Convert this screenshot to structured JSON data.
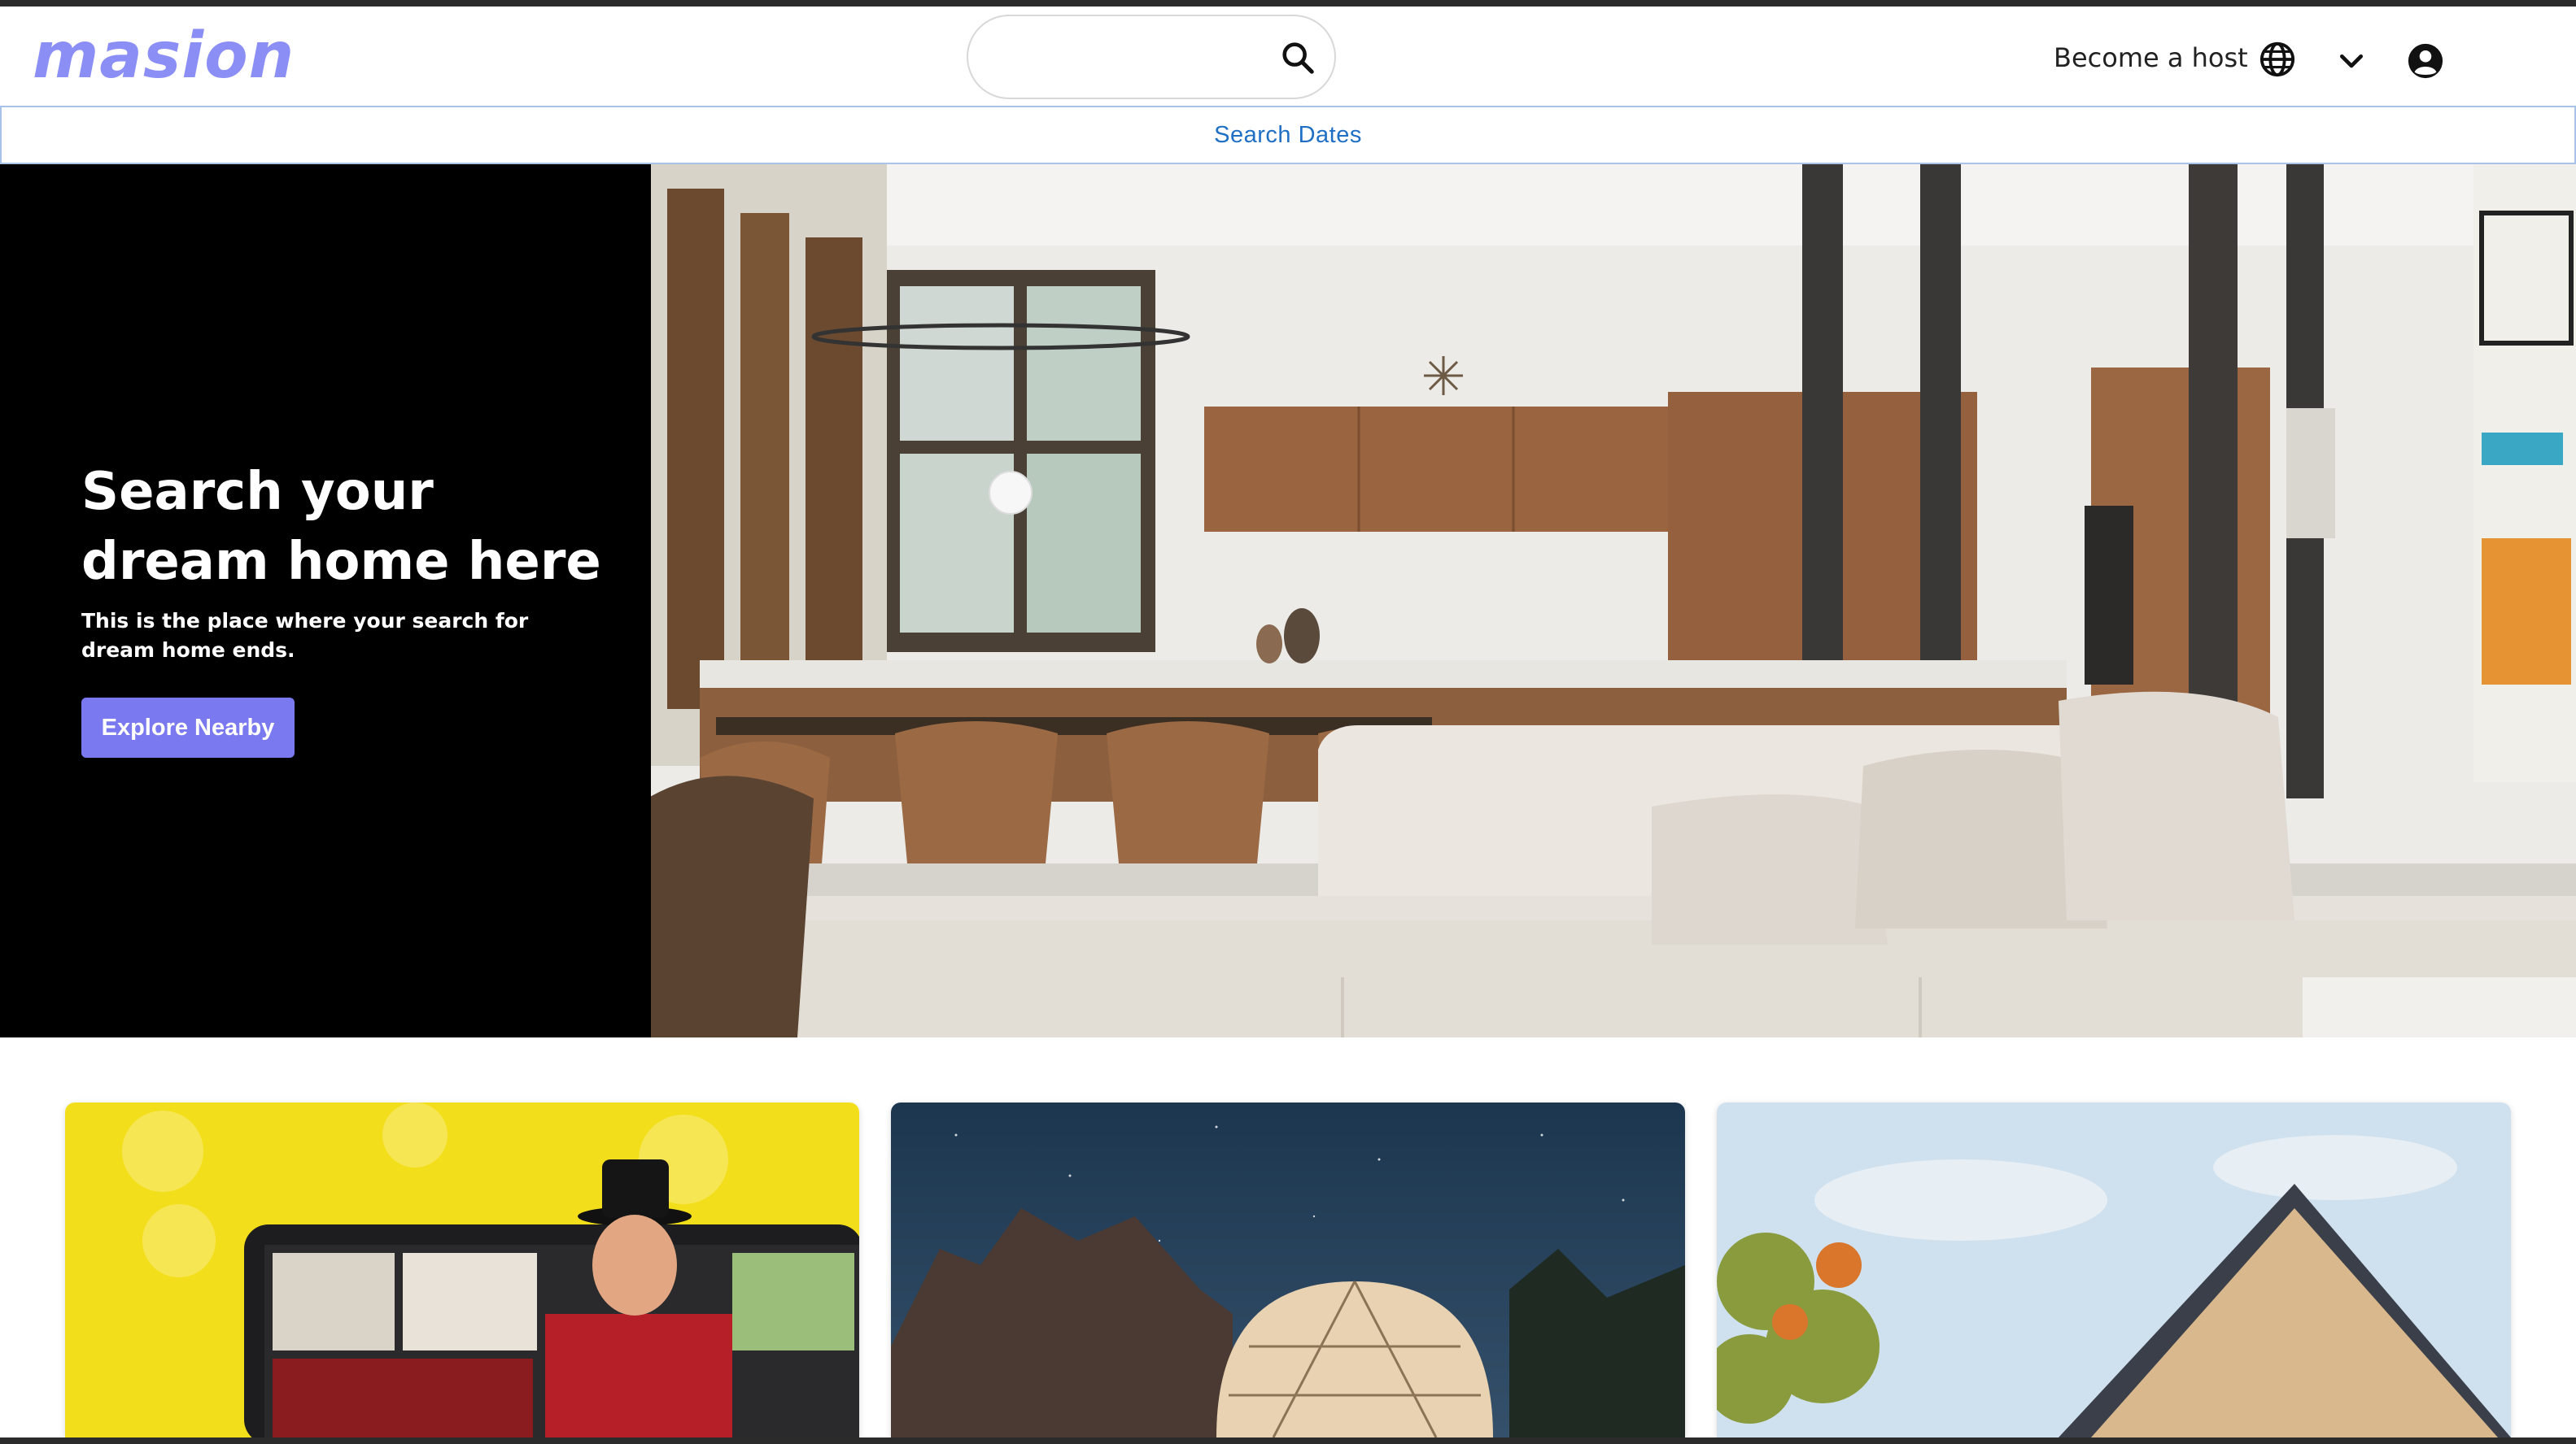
{
  "brand": {
    "logo_text": "masion"
  },
  "header": {
    "search": {
      "placeholder": "",
      "value": ""
    },
    "host_link": "Become a host"
  },
  "dates_bar": {
    "label": "Search Dates"
  },
  "hero": {
    "title": "Search your dream home here",
    "subtitle": "This is the place where your search for dream home ends.",
    "cta_label": "Explore Nearby"
  },
  "cards": [
    {
      "image": "online-experience-video-call"
    },
    {
      "image": "dome-under-night-sky"
    },
    {
      "image": "a-frame-cabin"
    }
  ],
  "colors": {
    "logo": "#8a8ef5",
    "accent": "#7b79f0",
    "dates_text": "#1f6fc5",
    "hero_panel": "#000000"
  },
  "icons": [
    "search-icon",
    "globe-icon",
    "chevron-down-icon",
    "account-icon"
  ]
}
